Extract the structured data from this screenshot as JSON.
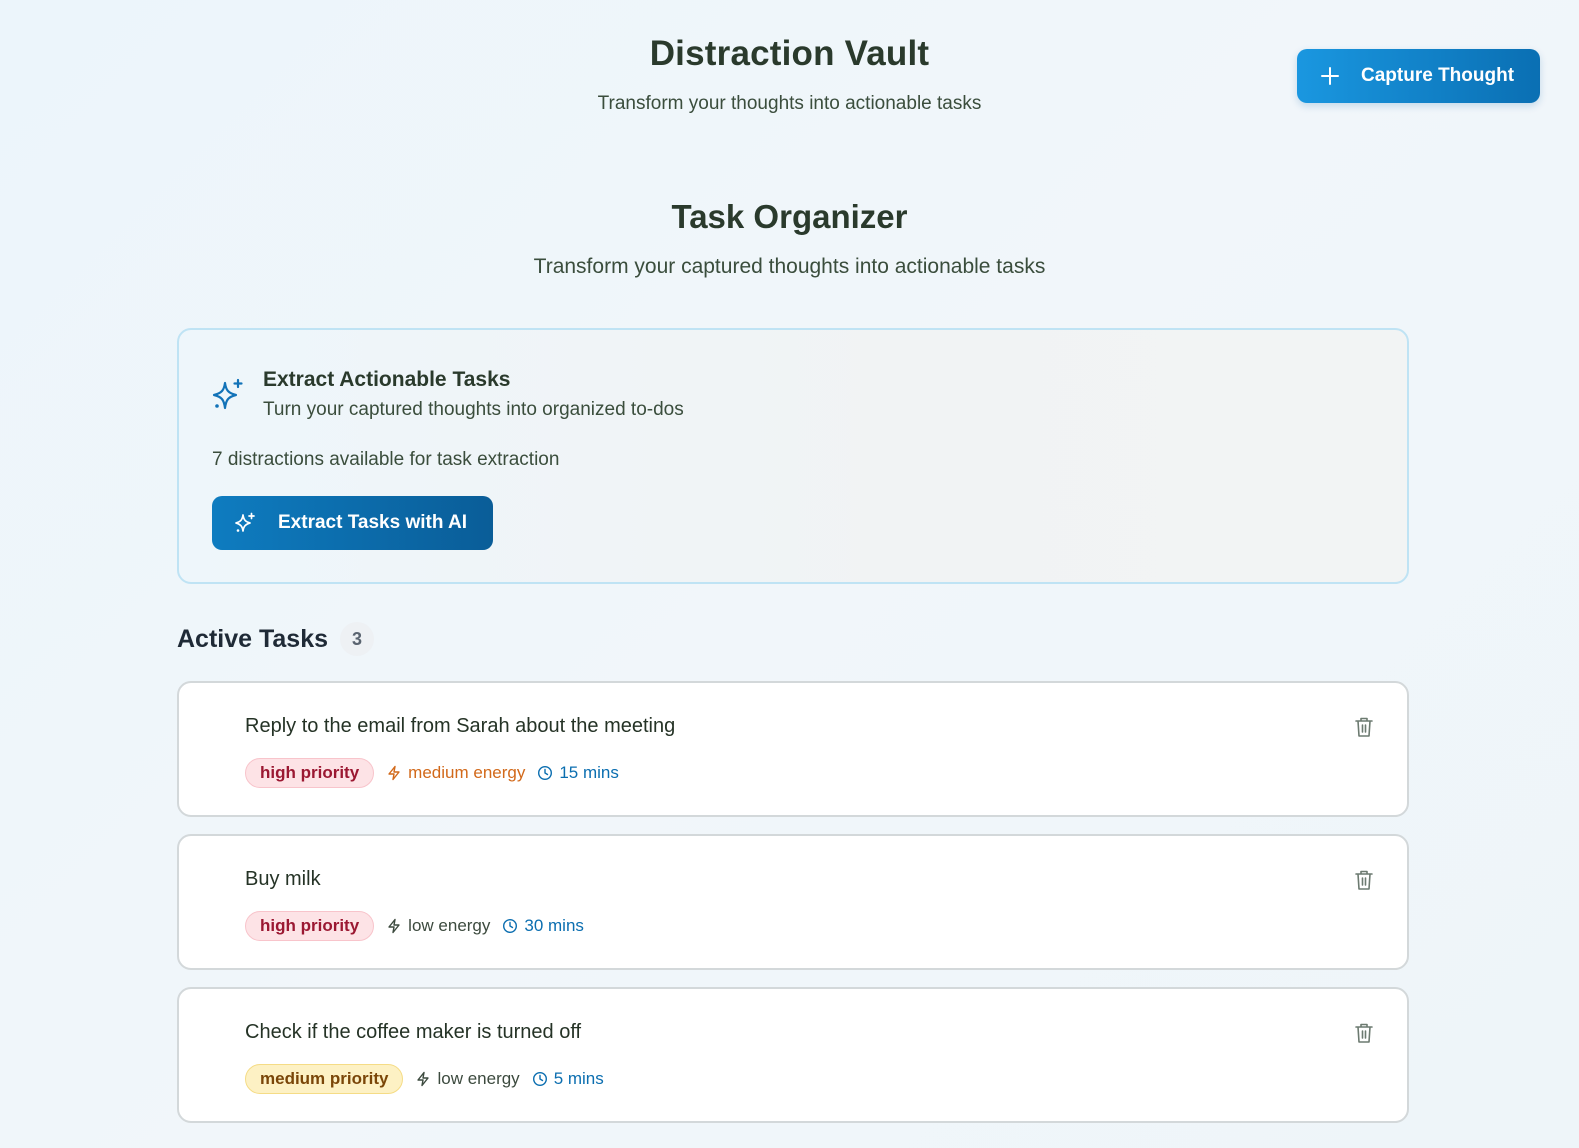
{
  "header": {
    "title": "Distraction Vault",
    "subtitle": "Transform your thoughts into actionable tasks",
    "capture_button": "Capture Thought"
  },
  "organizer": {
    "title": "Task Organizer",
    "subtitle": "Transform your captured thoughts into actionable tasks"
  },
  "extract": {
    "title": "Extract Actionable Tasks",
    "description": "Turn your captured thoughts into organized to-dos",
    "available": "7 distractions available for task extraction",
    "button": "Extract Tasks with AI"
  },
  "active": {
    "title": "Active Tasks",
    "count": "3"
  },
  "tasks": [
    {
      "text": "Reply to the email from Sarah about the meeting",
      "priority": "high priority",
      "energy": "medium energy",
      "duration": "15 mins"
    },
    {
      "text": "Buy milk",
      "priority": "high priority",
      "energy": "low energy",
      "duration": "30 mins"
    },
    {
      "text": "Check if the coffee maker is turned off",
      "priority": "medium priority",
      "energy": "low energy",
      "duration": "5 mins"
    }
  ],
  "colors": {
    "accent": "#1a97e0",
    "accent_dark": "#0a5d98",
    "high_priority": "#9b1832",
    "medium_priority": "#7a4608",
    "medium_energy": "#d2691a",
    "duration": "#0b6eb0"
  },
  "icons": {
    "capture": "plus-icon",
    "extract": "sparkles-icon",
    "energy": "lightning-icon",
    "duration": "clock-icon",
    "delete": "trash-icon"
  }
}
